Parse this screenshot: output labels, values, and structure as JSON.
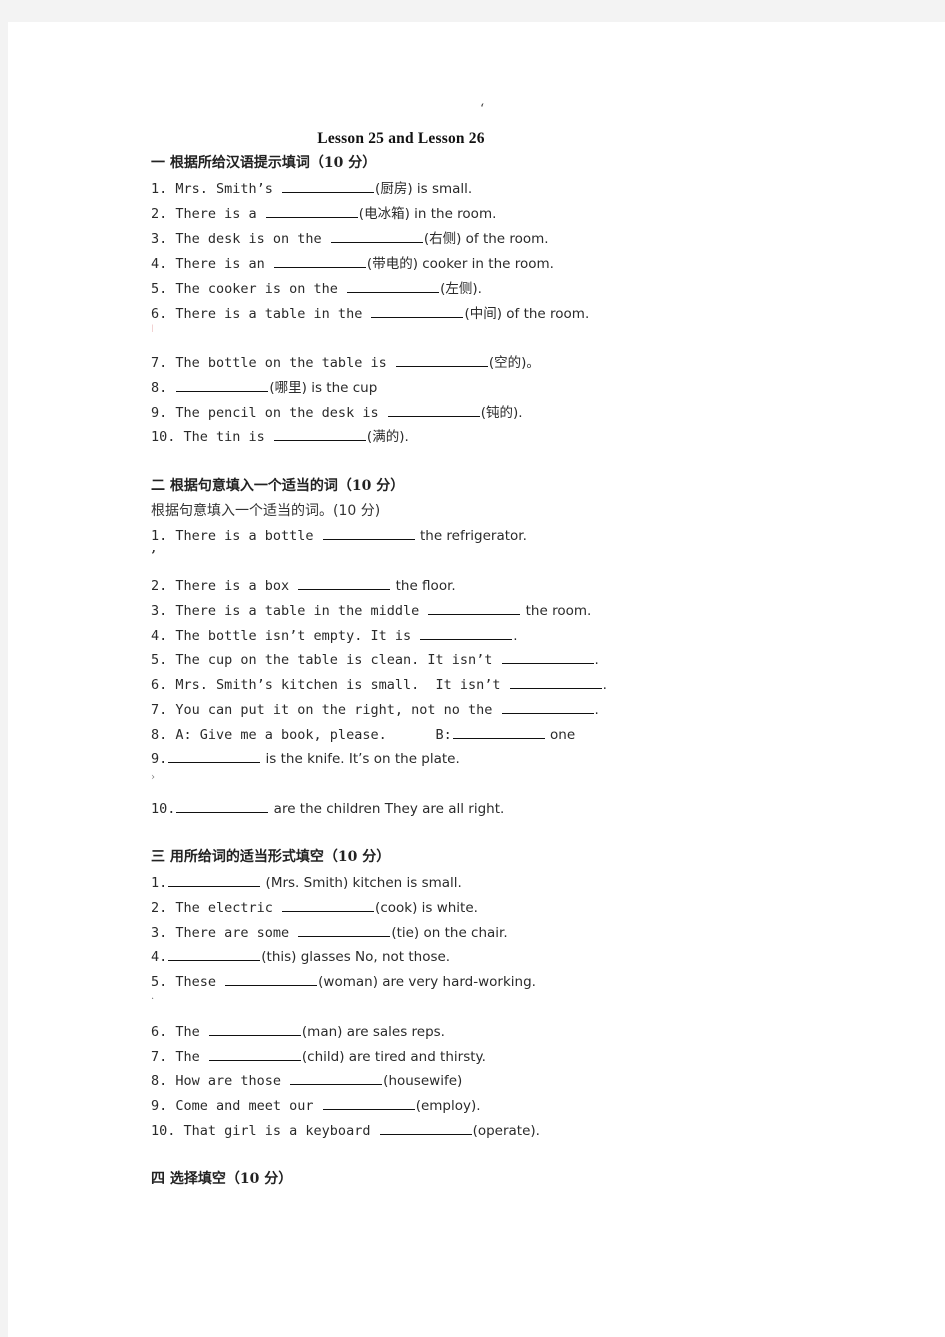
{
  "document": {
    "stray_mark_top": "‘",
    "title": "Lesson 25 and Lesson 26",
    "sections": [
      {
        "heading": "一 根据所给汉语提示填词（10 分）",
        "items": [
          {
            "pre": "1. Mrs. Smith’s ",
            "post": "(厨房) is small."
          },
          {
            "pre": "2. There is a ",
            "post": "(电冰箱) in the room."
          },
          {
            "pre": "3. The desk is on the ",
            "post": "(右侧) of the room."
          },
          {
            "pre": "4. There is an ",
            "post": "(带电的) cooker in the room."
          },
          {
            "pre": "5. The cooker is on the ",
            "post": "(左侧)."
          },
          {
            "pre": "6. There is a table in the ",
            "post": "(中间) of the room."
          },
          {
            "pre": "7. The bottle on the table is ",
            "post": "(空的)。"
          },
          {
            "pre": "8. ",
            "post": "(哪里) is the cup"
          },
          {
            "pre": "9. The pencil on the desk is ",
            "post": "(钝的)."
          },
          {
            "pre": "10. The tin is ",
            "post": "(满的)."
          }
        ]
      },
      {
        "heading": "二 根据句意填入一个适当的词（10 分）",
        "subheading": "根据句意填入一个适当的词。(10 分)",
        "items": [
          {
            "pre": "1. There is a bottle ",
            "post": " the refrigerator."
          },
          {
            "pre": "2. There is a box ",
            "post": " the floor."
          },
          {
            "pre": "3. There is a table in the middle ",
            "post": " the room."
          },
          {
            "pre": "4. The bottle isn’t empty. It is ",
            "post": "."
          },
          {
            "pre": "5. The cup on the table is clean. It isn’t ",
            "post": "."
          },
          {
            "pre": "6. Mrs. Smith’s kitchen is small.  It isn’t ",
            "post": "."
          },
          {
            "pre": "7. You can put it on the right, not no the ",
            "post": "."
          },
          {
            "pre": "8. A: Give me a book, please.      B:",
            "post": " one"
          },
          {
            "pre": "9.",
            "post": " is the knife. It’s on the plate."
          },
          {
            "pre": "10.",
            "post": " are the children They are all right."
          }
        ]
      },
      {
        "heading": "三 用所给词的适当形式填空（10 分）",
        "items": [
          {
            "pre": "1.",
            "post": " (Mrs. Smith) kitchen is small."
          },
          {
            "pre": "2. The electric ",
            "post": "(cook) is white."
          },
          {
            "pre": "3. There are some ",
            "post": "(tie) on the chair."
          },
          {
            "pre": "4.",
            "post": "(this) glasses No, not those."
          },
          {
            "pre": "5. These ",
            "post": "(woman) are very hard-working."
          },
          {
            "pre": "6. The ",
            "post": "(man) are sales reps."
          },
          {
            "pre": "7. The ",
            "post": "(child) are tired and thirsty."
          },
          {
            "pre": "8. How are those ",
            "post": "(housewife)"
          },
          {
            "pre": "9. Come and meet our ",
            "post": "(employ)."
          },
          {
            "pre": "10. That girl is a keyboard ",
            "post": "(operate)."
          }
        ]
      },
      {
        "heading": "四 选择填空（10 分）"
      }
    ],
    "stray_marks": {
      "after_s1_q6": "ǀ",
      "after_s2_q1": "ʼ",
      "after_s2_q9": "›",
      "after_s3_q5": "·"
    }
  }
}
